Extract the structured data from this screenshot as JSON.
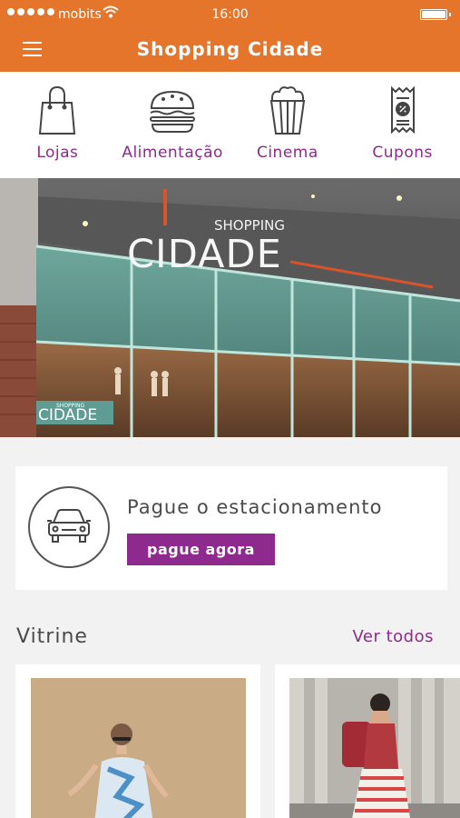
{
  "status": {
    "carrier": "mobits",
    "time": "16:00"
  },
  "header": {
    "title": "Shopping Cidade"
  },
  "categories": [
    {
      "label": "Lojas",
      "icon": "shopping-bag-icon"
    },
    {
      "label": "Alimentação",
      "icon": "burger-icon"
    },
    {
      "label": "Cinema",
      "icon": "popcorn-icon"
    },
    {
      "label": "Cupons",
      "icon": "coupon-icon"
    }
  ],
  "banner": {
    "sign_top": "SHOPPING",
    "sign_main": "CIDADE",
    "small_sign_top": "SHOPPING",
    "small_sign_main": "CIDADE"
  },
  "parking": {
    "title": "Pague o estacionamento",
    "button": "pague agora"
  },
  "vitrine": {
    "title": "Vitrine",
    "see_all": "Ver todos"
  },
  "colors": {
    "accent": "#e5752a",
    "brand_purple": "#8e2a8e",
    "background": "#f2f2f2"
  }
}
